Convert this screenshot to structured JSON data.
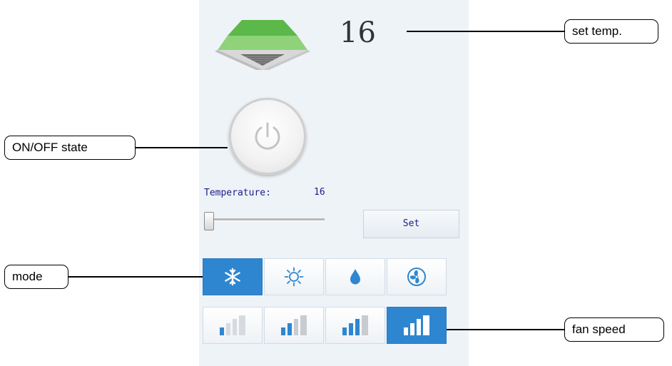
{
  "display": {
    "set_temp": "16"
  },
  "power": {
    "state": "off",
    "icon": "power-icon"
  },
  "temperature": {
    "label": "Temperature:",
    "value": "16",
    "slider_fraction": 0.0
  },
  "set_button": {
    "label": "Set"
  },
  "modes": [
    {
      "name": "cool",
      "icon": "snowflake-icon",
      "active": true
    },
    {
      "name": "heat",
      "icon": "sun-icon",
      "active": false
    },
    {
      "name": "dry",
      "icon": "water-drop-icon",
      "active": false
    },
    {
      "name": "fan",
      "icon": "fan-icon",
      "active": false
    }
  ],
  "fan_speeds": [
    {
      "level": 1,
      "active": false
    },
    {
      "level": 2,
      "active": false
    },
    {
      "level": 3,
      "active": false
    },
    {
      "level": 4,
      "active": true
    }
  ],
  "callouts": {
    "set_temp": "set temp.",
    "on_off": "ON/OFF state",
    "mode": "mode",
    "fan_speed": "fan speed"
  },
  "colors": {
    "accent": "#2f86d0",
    "panel_bg": "#eef3f8",
    "text_blue": "#1c1c8c"
  }
}
